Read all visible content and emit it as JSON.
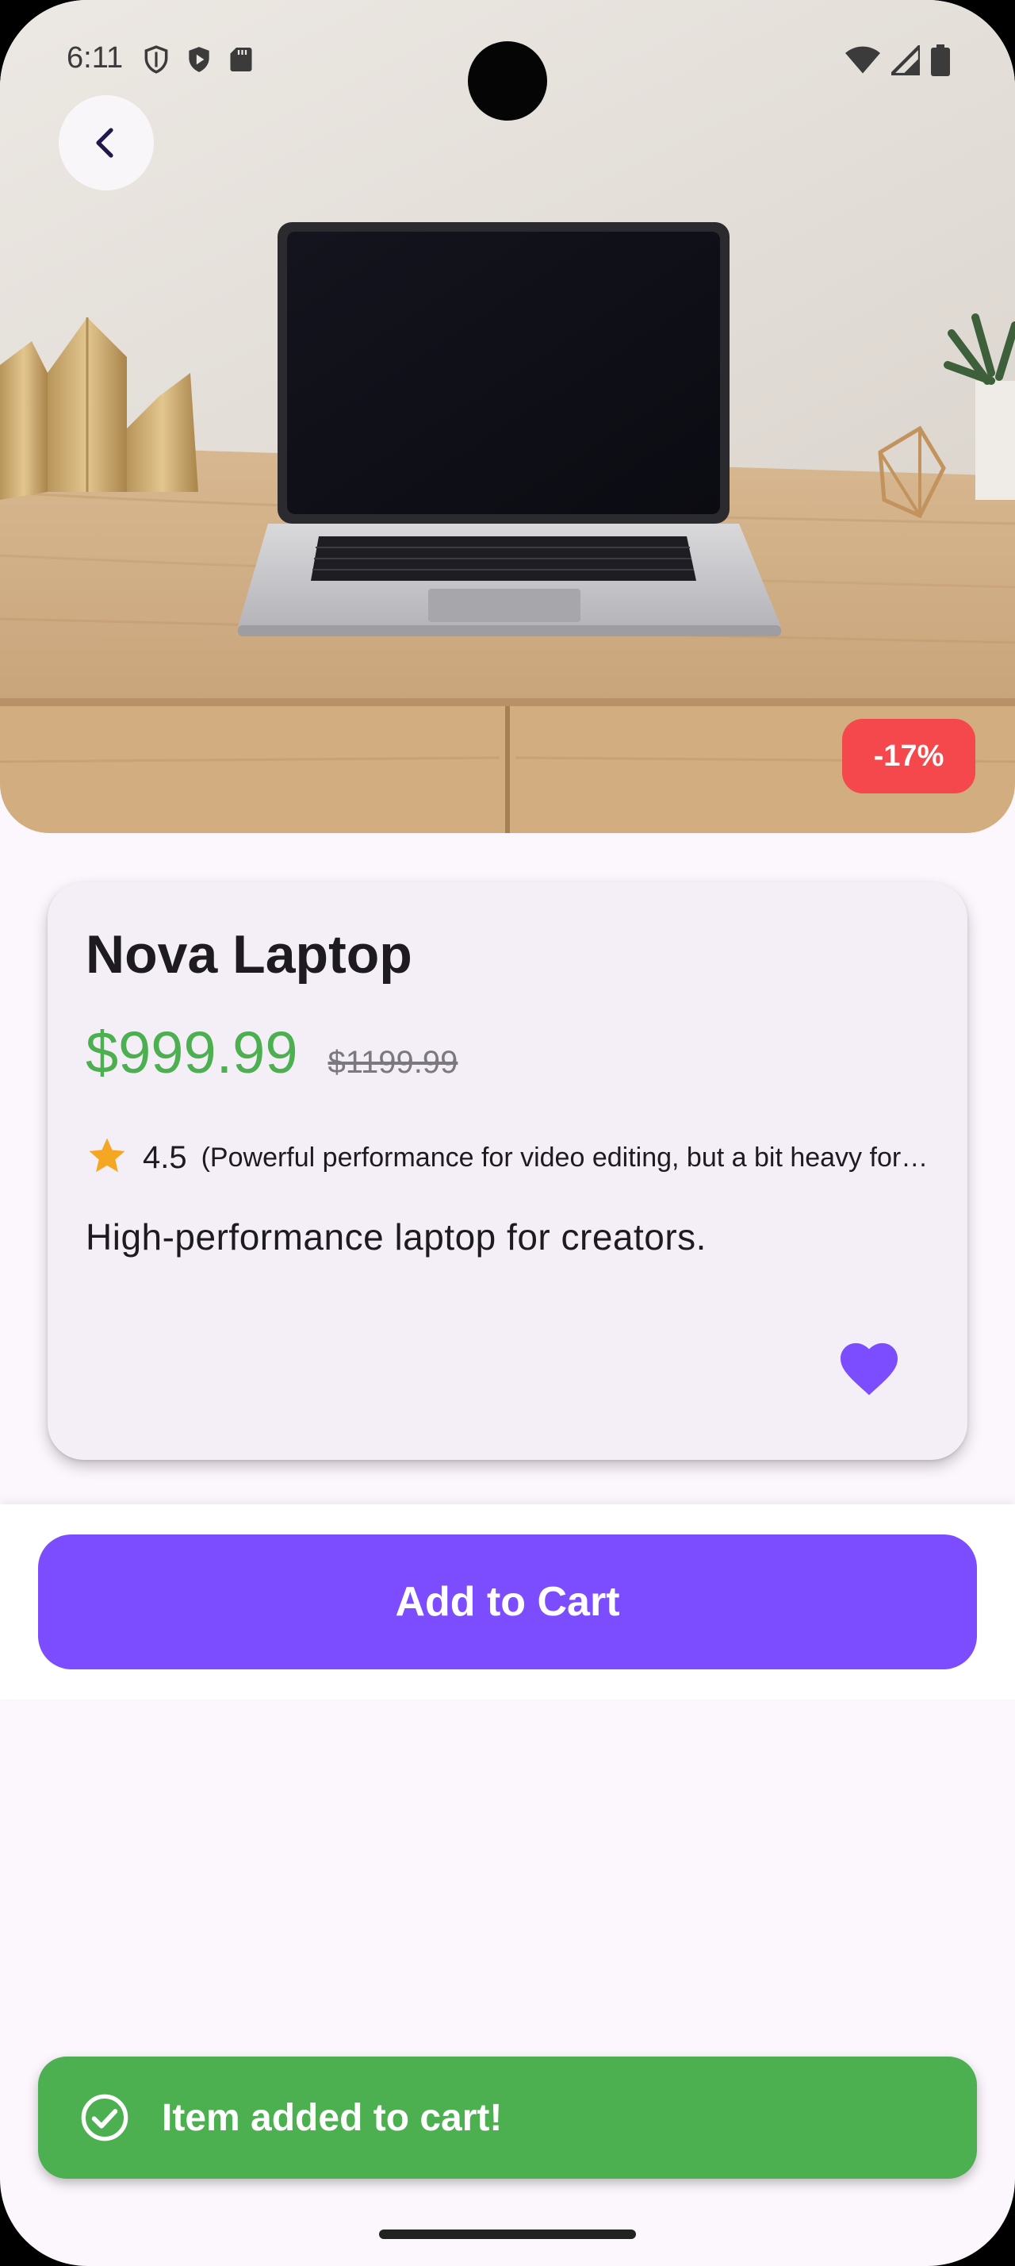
{
  "status_bar": {
    "time": "6:11",
    "left_icons": [
      "shield-icon",
      "play-protect-icon",
      "sd-card-icon"
    ],
    "right_icons": [
      "wifi-icon",
      "cell-signal-icon",
      "battery-icon"
    ]
  },
  "hero": {
    "image": "laptop-on-desk-photo",
    "back_icon": "back-arrow-icon",
    "discount_badge": "-17%"
  },
  "product": {
    "name": "Nova Laptop",
    "price": "$999.99",
    "original_price": "$1199.99",
    "rating": "4.5",
    "rating_icon": "star-icon",
    "review_snippet": "(Powerful performance for video editing, but a bit heavy for travel.)",
    "description": "High-performance laptop for creators.",
    "favorite_icon": "heart-filled-icon",
    "favorited": true
  },
  "actions": {
    "add_to_cart_label": "Add to Cart"
  },
  "snackbar": {
    "icon": "check-circle-icon",
    "message": "Item added to cart!"
  },
  "colors": {
    "background": "#fcf6fd",
    "card": "#f4eff6",
    "accent": "#7c4dff",
    "price": "#4caf50",
    "badge": "#f4484c",
    "snackbar": "#4caf50",
    "star": "#f5a623"
  }
}
